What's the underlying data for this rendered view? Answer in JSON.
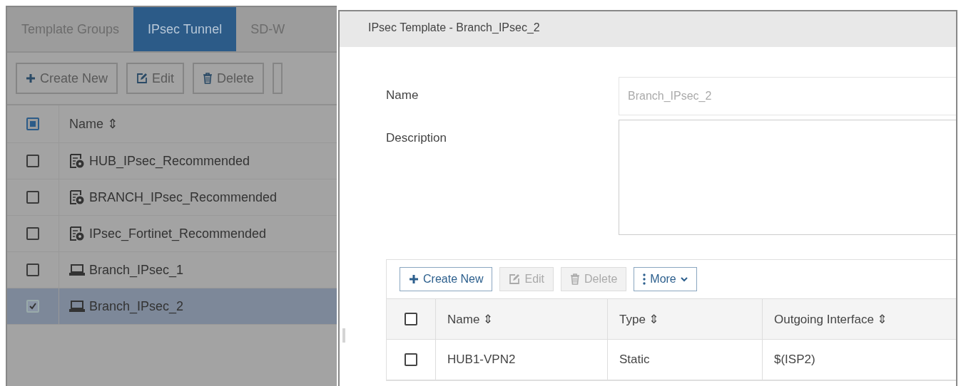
{
  "left_panel": {
    "tabs": [
      {
        "label": "Template Groups",
        "selected": false
      },
      {
        "label": "IPsec Tunnel",
        "selected": true
      },
      {
        "label": "SD-W",
        "selected": false
      }
    ],
    "toolbar": [
      {
        "label": "Create New",
        "kind": "plus"
      },
      {
        "label": "Edit",
        "kind": "edit"
      },
      {
        "label": "Delete",
        "kind": "trash"
      }
    ],
    "table": {
      "select_all": {
        "indeterminate": true
      },
      "columns": [
        "Name ⇕"
      ],
      "rows": [
        {
          "name": "HUB_IPsec_Recommended",
          "kind": "template",
          "checked": false,
          "selected": false
        },
        {
          "name": "BRANCH_IPsec_Recommended",
          "kind": "template",
          "checked": false,
          "selected": false
        },
        {
          "name": "IPsec_Fortinet_Recommended",
          "kind": "template",
          "checked": false,
          "selected": false
        },
        {
          "name": "Branch_IPsec_1",
          "kind": "device",
          "checked": false,
          "selected": false
        },
        {
          "name": "Branch_IPsec_2",
          "kind": "device",
          "checked": true,
          "selected": true
        }
      ]
    }
  },
  "dialog": {
    "title": "IPsec Template - Branch_IPsec_2",
    "fields": [
      {
        "label": "Name",
        "kind": "input",
        "value": "Branch_IPsec_2",
        "disabled": true
      },
      {
        "label": "Description",
        "kind": "textarea"
      }
    ],
    "toolbar": [
      {
        "label": "Create New",
        "kind": "plus",
        "disabled": false
      },
      {
        "label": "Edit",
        "kind": "edit",
        "disabled": true
      },
      {
        "label": "Delete",
        "kind": "trash",
        "disabled": true
      },
      {
        "label": "More",
        "kind": "more",
        "disabled": false
      }
    ],
    "table": {
      "select_all": {
        "checked": false
      },
      "columns": [
        "Name ⇕",
        "Type ⇕",
        "Outgoing Interface ⇕"
      ],
      "rows": [
        {
          "cells": [
            "HUB1-VPN2",
            "Static",
            "$(ISP2)"
          ],
          "checked": false
        }
      ]
    }
  }
}
